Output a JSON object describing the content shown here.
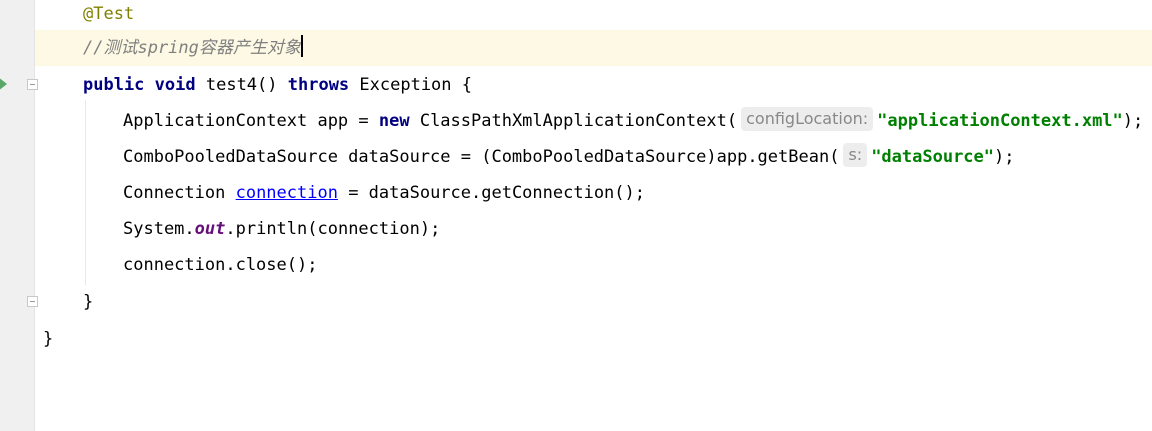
{
  "editor": {
    "lines": [
      {
        "annotation": "@Test"
      },
      {
        "comment": "//测试spring容器产生对象"
      },
      {
        "kw_public": "public",
        "kw_void": "void",
        "method_sig": " test4() ",
        "kw_throws": "throws",
        "rest": " Exception {"
      },
      {
        "prefix": "ApplicationContext app = ",
        "kw_new": "new",
        "mid": " ClassPathXmlApplicationContext(",
        "hint": "configLocation:",
        "string": "\"applicationContext.xml\"",
        "suffix": ");"
      },
      {
        "prefix": "ComboPooledDataSource dataSource = (ComboPooledDataSource)app.getBean(",
        "hint": "s:",
        "string": "\"dataSource\"",
        "suffix": ");"
      },
      {
        "prefix": "Connection ",
        "link": "connection",
        "suffix": " = dataSource.getConnection();"
      },
      {
        "prefix": "System.",
        "field": "out",
        "suffix": ".println(connection);"
      },
      {
        "text": "connection.close();"
      },
      {
        "text": "}"
      },
      {
        "text": "}"
      }
    ]
  }
}
